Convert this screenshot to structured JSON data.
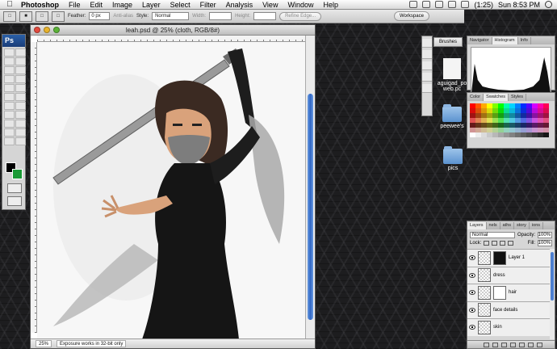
{
  "menubar": {
    "app_name": "Photoshop",
    "items": [
      "File",
      "Edit",
      "Image",
      "Layer",
      "Select",
      "Filter",
      "Analysis",
      "View",
      "Window",
      "Help"
    ],
    "battery": "(1:25)",
    "clock": "Sun 8:53 PM"
  },
  "options": {
    "feather_label": "Feather:",
    "feather_value": "0 px",
    "antialias_label": "Anti-alias",
    "style_label": "Style:",
    "style_value": "Normal",
    "width_label": "Width:",
    "height_label": "Height:",
    "refine_label": "Refine Edge...",
    "workspace_label": "Workspace"
  },
  "tools": {
    "logo": "Ps"
  },
  "document": {
    "title": "leah.psd @ 25% (cloth, RGB/8#)",
    "zoom": "25%",
    "status": "Exposure works in 32-bit only"
  },
  "side_panel": {
    "brushes_tab": "Brushes"
  },
  "desktop": {
    "icons": [
      {
        "label": "aguigad_po web.pc"
      },
      {
        "label": "peewee's"
      },
      {
        "label": "pics"
      }
    ]
  },
  "navigator_panel": {
    "tabs": [
      "Navigator",
      "Histogram",
      "Info"
    ]
  },
  "swatches_panel": {
    "tabs": [
      "Color",
      "Swatches",
      "Styles"
    ]
  },
  "layers_panel": {
    "tabs": [
      "Layers",
      "nels",
      "aths",
      "story",
      "ions"
    ],
    "blend_mode": "Normal",
    "opacity_label": "Opacity:",
    "opacity_value": "100%",
    "lock_label": "Lock:",
    "fill_label": "Fill:",
    "fill_value": "100%",
    "layers": [
      {
        "name": "Layer 1"
      },
      {
        "name": "dress"
      },
      {
        "name": "hair"
      },
      {
        "name": "face details"
      },
      {
        "name": "skin"
      }
    ]
  },
  "colors": {
    "accent": "#2f66c4",
    "foreground": "#000000",
    "background": "#1a9a36"
  }
}
